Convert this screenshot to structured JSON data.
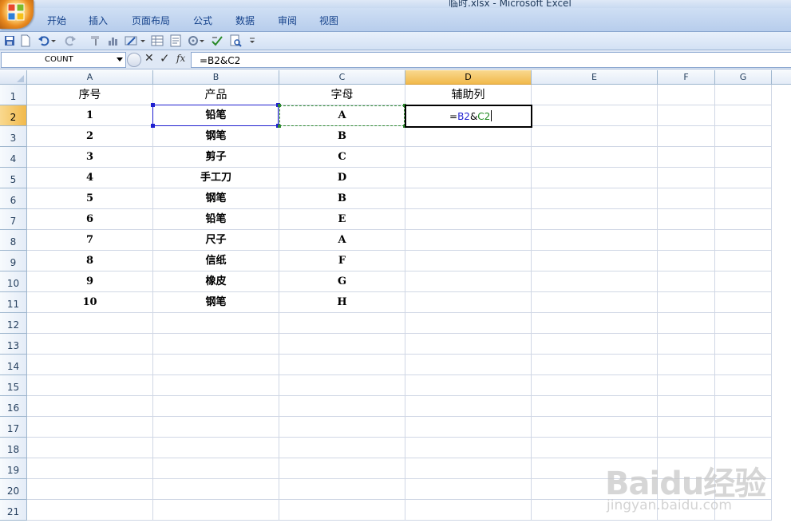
{
  "window": {
    "title": "临时.xlsx - Microsoft Excel"
  },
  "ribbon": {
    "tabs": [
      {
        "label": "开始"
      },
      {
        "label": "插入"
      },
      {
        "label": "页面布局"
      },
      {
        "label": "公式"
      },
      {
        "label": "数据"
      },
      {
        "label": "审阅"
      },
      {
        "label": "视图"
      }
    ]
  },
  "quick_access": {
    "icons": [
      "save-icon",
      "new-icon",
      "undo-icon",
      "redo-icon",
      "format-painter-icon",
      "chart-icon",
      "draw-icon",
      "table-icon",
      "form-icon",
      "tools-icon",
      "spelling-icon",
      "print-preview-icon",
      "customize-icon"
    ]
  },
  "formula_bar": {
    "name_box": "COUNT",
    "formula": "=B2&C2",
    "fx_label": "fx"
  },
  "sheet": {
    "columns": [
      "A",
      "B",
      "C",
      "D",
      "E",
      "F",
      "G"
    ],
    "rows": [
      "1",
      "2",
      "3",
      "4",
      "5",
      "6",
      "7",
      "8",
      "9",
      "10",
      "11",
      "12",
      "13",
      "14",
      "15",
      "16",
      "17",
      "18",
      "19",
      "20",
      "21"
    ],
    "header_row": [
      "序号",
      "产品",
      "字母",
      "辅助列"
    ],
    "data": [
      [
        "1",
        "铅笔",
        "A"
      ],
      [
        "2",
        "钢笔",
        "B"
      ],
      [
        "3",
        "剪子",
        "C"
      ],
      [
        "4",
        "手工刀",
        "D"
      ],
      [
        "5",
        "钢笔",
        "B"
      ],
      [
        "6",
        "铅笔",
        "E"
      ],
      [
        "7",
        "尺子",
        "A"
      ],
      [
        "8",
        "信纸",
        "F"
      ],
      [
        "9",
        "橡皮",
        "G"
      ],
      [
        "10",
        "钢笔",
        "H"
      ]
    ],
    "active_cell": "D2",
    "edit_parts": {
      "eq": "=",
      "ref1": "B2",
      "amp": "&",
      "ref2": "C2"
    }
  },
  "watermark": {
    "brand": "Baidu经验",
    "url": "jingyan.baidu.com"
  },
  "colors": {
    "ref_blue": "#1f1fd0",
    "ref_green": "#1e8a1e",
    "selected_header": "#f1b94b"
  }
}
